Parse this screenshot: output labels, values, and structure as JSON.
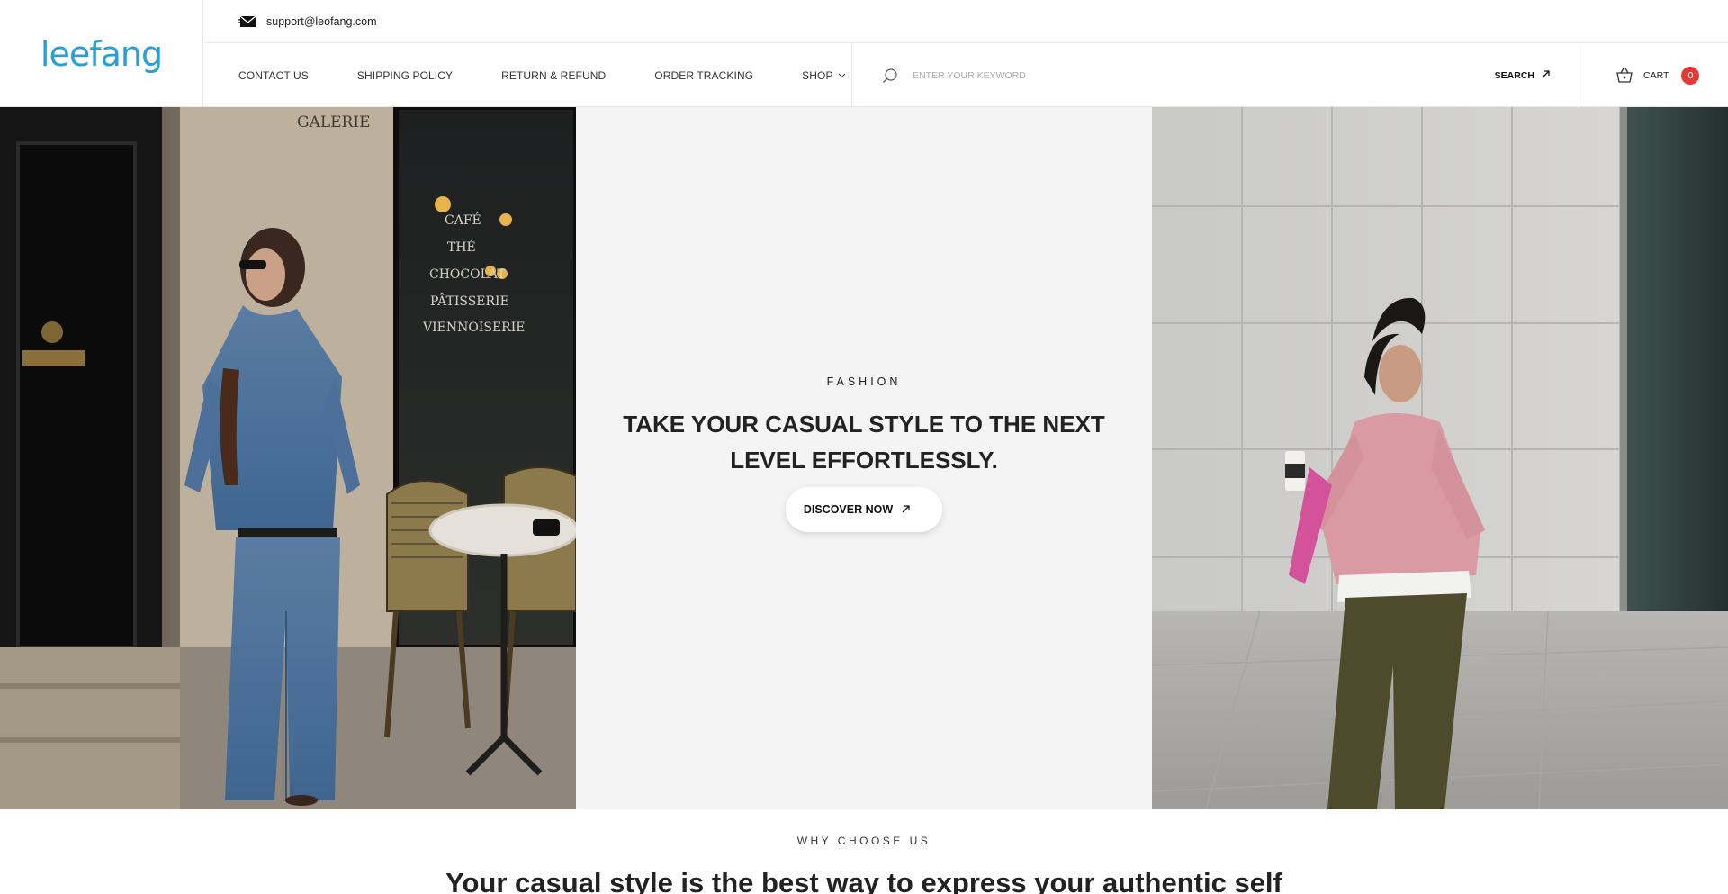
{
  "brand": {
    "logo_text": "leefang",
    "logo_color": "#2a9fd6"
  },
  "topbar": {
    "email": "support@leofang.com"
  },
  "nav": {
    "items": [
      {
        "label": "CONTACT US"
      },
      {
        "label": "SHIPPING POLICY"
      },
      {
        "label": "RETURN & REFUND"
      },
      {
        "label": "ORDER TRACKING"
      },
      {
        "label": "SHOP"
      }
    ]
  },
  "search": {
    "placeholder": "ENTER YOUR KEYWORD",
    "button_label": "SEARCH"
  },
  "cart": {
    "label": "CART",
    "count": "0",
    "badge_color": "#e53935"
  },
  "hero": {
    "eyebrow": "FASHION",
    "title": "TAKE YOUR CASUAL STYLE TO THE NEXT LEVEL EFFORTLESSLY.",
    "cta_label": "DISCOVER NOW",
    "left_sign_text": [
      "GALERIE",
      "CAFÉ",
      "THÉ",
      "CHOCOLAT",
      "PÂTISSERIE",
      "VIENNOISERIE"
    ]
  },
  "why": {
    "eyebrow": "WHY CHOOSE US",
    "heading": "Your casual style is the best way to express your authentic self"
  },
  "icons": {
    "mail": "envelope-icon",
    "search": "search-icon",
    "arrow": "arrow-up-right-icon",
    "cart": "basket-icon",
    "chevron": "chevron-down-icon"
  }
}
